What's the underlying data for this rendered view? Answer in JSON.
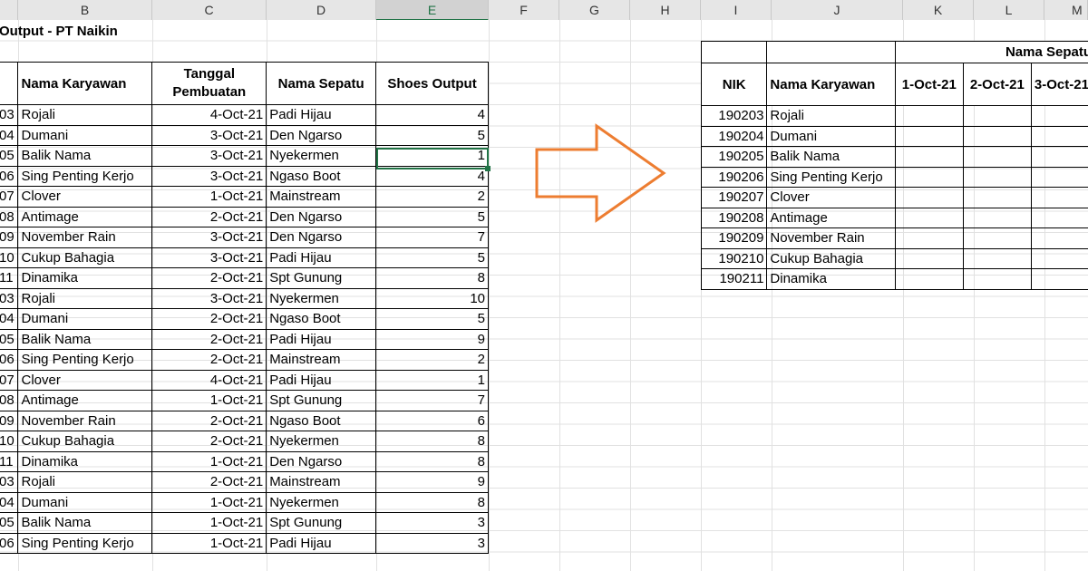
{
  "columns": [
    "B",
    "C",
    "D",
    "E",
    "F",
    "G",
    "H",
    "I",
    "J",
    "K",
    "L",
    "M"
  ],
  "title": "Output - PT Naikin",
  "left_table": {
    "headers": [
      "Nama Karyawan",
      "Tanggal Pembuatan",
      "Nama Sepatu",
      "Shoes Output"
    ],
    "rows": [
      {
        "nik": "03",
        "name": "Rojali",
        "date": "4-Oct-21",
        "shoe": "Padi Hijau",
        "qty": "4"
      },
      {
        "nik": "04",
        "name": "Dumani",
        "date": "3-Oct-21",
        "shoe": "Den Ngarso",
        "qty": "5"
      },
      {
        "nik": "05",
        "name": "Balik Nama",
        "date": "3-Oct-21",
        "shoe": "Nyekermen",
        "qty": "1"
      },
      {
        "nik": "06",
        "name": "Sing Penting Kerjo",
        "date": "3-Oct-21",
        "shoe": "Ngaso Boot",
        "qty": "4"
      },
      {
        "nik": "07",
        "name": "Clover",
        "date": "1-Oct-21",
        "shoe": "Mainstream",
        "qty": "2"
      },
      {
        "nik": "08",
        "name": "Antimage",
        "date": "2-Oct-21",
        "shoe": "Den Ngarso",
        "qty": "5"
      },
      {
        "nik": "09",
        "name": "November Rain",
        "date": "3-Oct-21",
        "shoe": "Den Ngarso",
        "qty": "7"
      },
      {
        "nik": "10",
        "name": "Cukup Bahagia",
        "date": "3-Oct-21",
        "shoe": "Padi Hijau",
        "qty": "5"
      },
      {
        "nik": "11",
        "name": "Dinamika",
        "date": "2-Oct-21",
        "shoe": "Spt Gunung",
        "qty": "8"
      },
      {
        "nik": "03",
        "name": "Rojali",
        "date": "3-Oct-21",
        "shoe": "Nyekermen",
        "qty": "10"
      },
      {
        "nik": "04",
        "name": "Dumani",
        "date": "2-Oct-21",
        "shoe": "Ngaso Boot",
        "qty": "5"
      },
      {
        "nik": "05",
        "name": "Balik Nama",
        "date": "2-Oct-21",
        "shoe": "Padi Hijau",
        "qty": "9"
      },
      {
        "nik": "06",
        "name": "Sing Penting Kerjo",
        "date": "2-Oct-21",
        "shoe": "Mainstream",
        "qty": "2"
      },
      {
        "nik": "07",
        "name": "Clover",
        "date": "4-Oct-21",
        "shoe": "Padi Hijau",
        "qty": "1"
      },
      {
        "nik": "08",
        "name": "Antimage",
        "date": "1-Oct-21",
        "shoe": "Spt Gunung",
        "qty": "7"
      },
      {
        "nik": "09",
        "name": "November Rain",
        "date": "2-Oct-21",
        "shoe": "Ngaso Boot",
        "qty": "6"
      },
      {
        "nik": "10",
        "name": "Cukup Bahagia",
        "date": "2-Oct-21",
        "shoe": "Nyekermen",
        "qty": "8"
      },
      {
        "nik": "11",
        "name": "Dinamika",
        "date": "1-Oct-21",
        "shoe": "Den Ngarso",
        "qty": "8"
      },
      {
        "nik": "03",
        "name": "Rojali",
        "date": "2-Oct-21",
        "shoe": "Mainstream",
        "qty": "9"
      },
      {
        "nik": "04",
        "name": "Dumani",
        "date": "1-Oct-21",
        "shoe": "Nyekermen",
        "qty": "8"
      },
      {
        "nik": "05",
        "name": "Balik Nama",
        "date": "1-Oct-21",
        "shoe": "Spt Gunung",
        "qty": "3"
      },
      {
        "nik": "06",
        "name": "Sing Penting Kerjo",
        "date": "1-Oct-21",
        "shoe": "Padi Hijau",
        "qty": "3"
      }
    ]
  },
  "right_table": {
    "group_header": "Nama Sepatu",
    "headers": [
      "NIK",
      "Nama Karyawan",
      "1-Oct-21",
      "2-Oct-21",
      "3-Oct-21"
    ],
    "rows": [
      {
        "nik": "190203",
        "name": "Rojali"
      },
      {
        "nik": "190204",
        "name": "Dumani"
      },
      {
        "nik": "190205",
        "name": "Balik Nama"
      },
      {
        "nik": "190206",
        "name": "Sing Penting Kerjo"
      },
      {
        "nik": "190207",
        "name": "Clover"
      },
      {
        "nik": "190208",
        "name": "Antimage"
      },
      {
        "nik": "190209",
        "name": "November Rain"
      },
      {
        "nik": "190210",
        "name": "Cukup Bahagia"
      },
      {
        "nik": "190211",
        "name": "Dinamika"
      }
    ]
  },
  "colors": {
    "arrow": "#ed7d31",
    "selection": "#217346"
  },
  "arrow_icon": "right-arrow-icon"
}
